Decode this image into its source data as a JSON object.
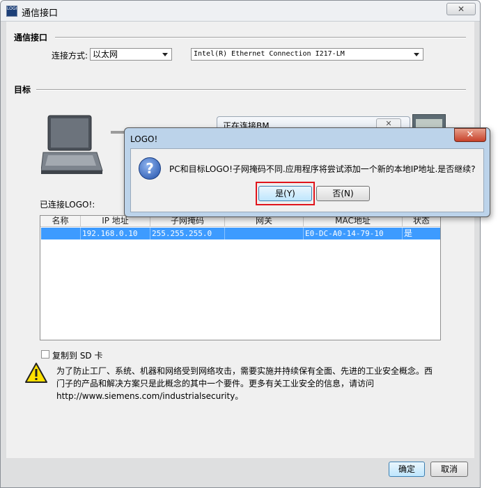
{
  "window": {
    "title": "通信接口",
    "close_glyph": "✕"
  },
  "section_comm": {
    "heading": "通信接口",
    "connection_label": "连接方式:",
    "connection_value": "以太网",
    "adapter_value": "Intel(R) Ethernet Connection I217-LM"
  },
  "section_target": {
    "heading": "目标",
    "connecting_title": "正在连接BM...",
    "connecting_close": "✕",
    "connected_label": "已连接LOGO!:",
    "char_hidden": "E"
  },
  "table": {
    "columns": [
      "名称",
      "IP 地址",
      "子网掩码",
      "网关",
      "MAC地址",
      "状态"
    ],
    "rows": [
      [
        "",
        "192.168.0.10",
        "255.255.255.0",
        "",
        "E0-DC-A0-14-79-10",
        "是"
      ]
    ]
  },
  "sd": {
    "label": "复制到 SD 卡",
    "checked": false
  },
  "notice": {
    "line1": "为了防止工厂、系统、机器和网络受到网络攻击，需要实施并持续保有全面、先进的工业安全概念。西",
    "line2": "门子的产品和解决方案只是此概念的其中一个要件。更多有关工业安全的信息，请访问",
    "line3": "http://www.siemens.com/industrialsecurity。"
  },
  "buttons": {
    "ok": "确定",
    "cancel": "取消"
  },
  "modal": {
    "title": "LOGO!",
    "close_glyph": "✕",
    "icon_glyph": "?",
    "message": "PC和目标LOGO!子网掩码不同.应用程序将尝试添加一个新的本地IP地址.是否继续?",
    "yes": "是(Y)",
    "no": "否(N)"
  },
  "colors": {
    "selection": "#3d9bff",
    "highlight_box": "#e0141c"
  }
}
